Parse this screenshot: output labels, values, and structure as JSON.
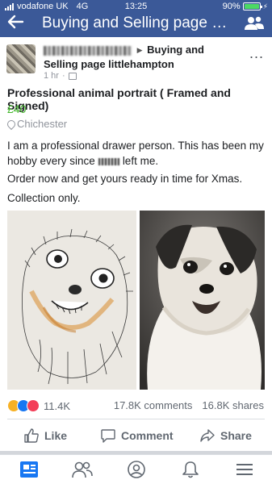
{
  "status_bar": {
    "carrier": "vodafone UK",
    "network": "4G",
    "time": "13:25",
    "battery": "90%",
    "battery_level": 0.9
  },
  "header": {
    "title": "Buying and Selling page littl...",
    "back_icon": "back-arrow-icon",
    "groups_icon": "groups-icon"
  },
  "post": {
    "group_name": "Buying and Selling page littlehampton",
    "timestamp": "1 hr",
    "more_label": "..."
  },
  "listing": {
    "title": "Professional animal portrait ( Framed and Signed)",
    "price": "£40",
    "location": "Chichester",
    "description_part1": "I am a professional drawer person. This has been my hobby every since",
    "description_part2": "left me.",
    "description_line2": "Order now and get yours ready in time for Xmas.",
    "description_line3": "Collection only."
  },
  "engagement": {
    "reactions_count": "11.4K",
    "comments": "17.8K comments",
    "shares": "16.8K shares"
  },
  "actions": {
    "like": "Like",
    "comment": "Comment",
    "share": "Share"
  },
  "tabbar": [
    "news-feed-icon",
    "friends-icon",
    "profile-icon",
    "notifications-icon",
    "menu-icon"
  ],
  "colors": {
    "facebook_blue": "#3b5998",
    "price_green": "#42b72a",
    "like_blue": "#1877f2"
  }
}
